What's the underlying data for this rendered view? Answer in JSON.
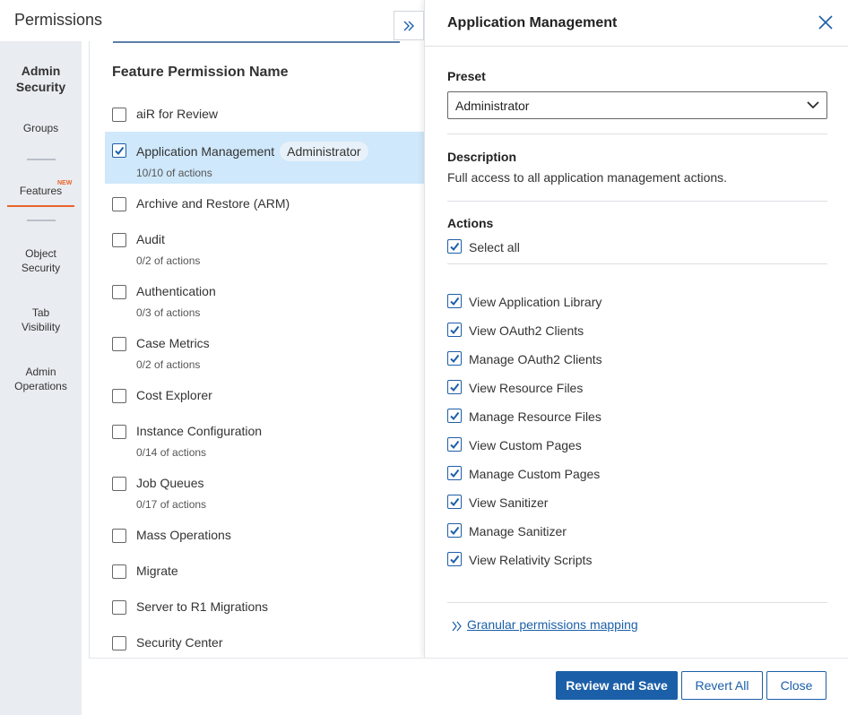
{
  "window": {
    "title": "Permissions"
  },
  "sidebar": {
    "title": "Admin Security",
    "items": [
      {
        "label": "Groups"
      },
      {
        "label": "Features",
        "badge": "NEW"
      },
      {
        "label": "Object Security"
      },
      {
        "label": "Tab Visibility"
      },
      {
        "label": "Admin Operations"
      }
    ]
  },
  "list": {
    "heading": "Feature Permission Name",
    "features": [
      {
        "name": "aiR for Review",
        "checked": false
      },
      {
        "name": "Application Management",
        "badge": "Administrator",
        "sub": "10/10 of actions",
        "checked": true,
        "selected": true
      },
      {
        "name": "Archive and Restore (ARM)",
        "checked": false
      },
      {
        "name": "Audit",
        "sub": "0/2 of actions",
        "checked": false
      },
      {
        "name": "Authentication",
        "sub": "0/3 of actions",
        "checked": false
      },
      {
        "name": "Case Metrics",
        "sub": "0/2 of actions",
        "checked": false
      },
      {
        "name": "Cost Explorer",
        "checked": false
      },
      {
        "name": "Instance Configuration",
        "sub": "0/14 of actions",
        "checked": false
      },
      {
        "name": "Job Queues",
        "sub": "0/17 of actions",
        "checked": false
      },
      {
        "name": "Mass Operations",
        "checked": false
      },
      {
        "name": "Migrate",
        "checked": false
      },
      {
        "name": "Server to R1 Migrations",
        "checked": false
      },
      {
        "name": "Security Center",
        "checked": false
      }
    ]
  },
  "detail": {
    "title": "Application Management",
    "preset_label": "Preset",
    "preset_value": "Administrator",
    "description_label": "Description",
    "description": "Full access to all application management actions.",
    "actions_label": "Actions",
    "select_all": "Select all",
    "actions": [
      "View Application Library",
      "View OAuth2 Clients",
      "Manage OAuth2 Clients",
      "View Resource Files",
      "Manage Resource Files",
      "View Custom Pages",
      "Manage Custom Pages",
      "View Sanitizer",
      "Manage Sanitizer",
      "View Relativity Scripts"
    ],
    "granular_link": "Granular permissions mapping"
  },
  "footer": {
    "review_save": "Review and Save",
    "revert_all": "Revert All",
    "close": "Close"
  },
  "colors": {
    "accent": "#1b5fa8",
    "selected_row": "#cfe8fb",
    "sidebar_bg": "#e9ecf1",
    "new_badge": "#e8642a"
  },
  "icons": [
    "double-chevron-right-icon",
    "close-icon",
    "chevron-down-icon",
    "checkmark-icon"
  ]
}
